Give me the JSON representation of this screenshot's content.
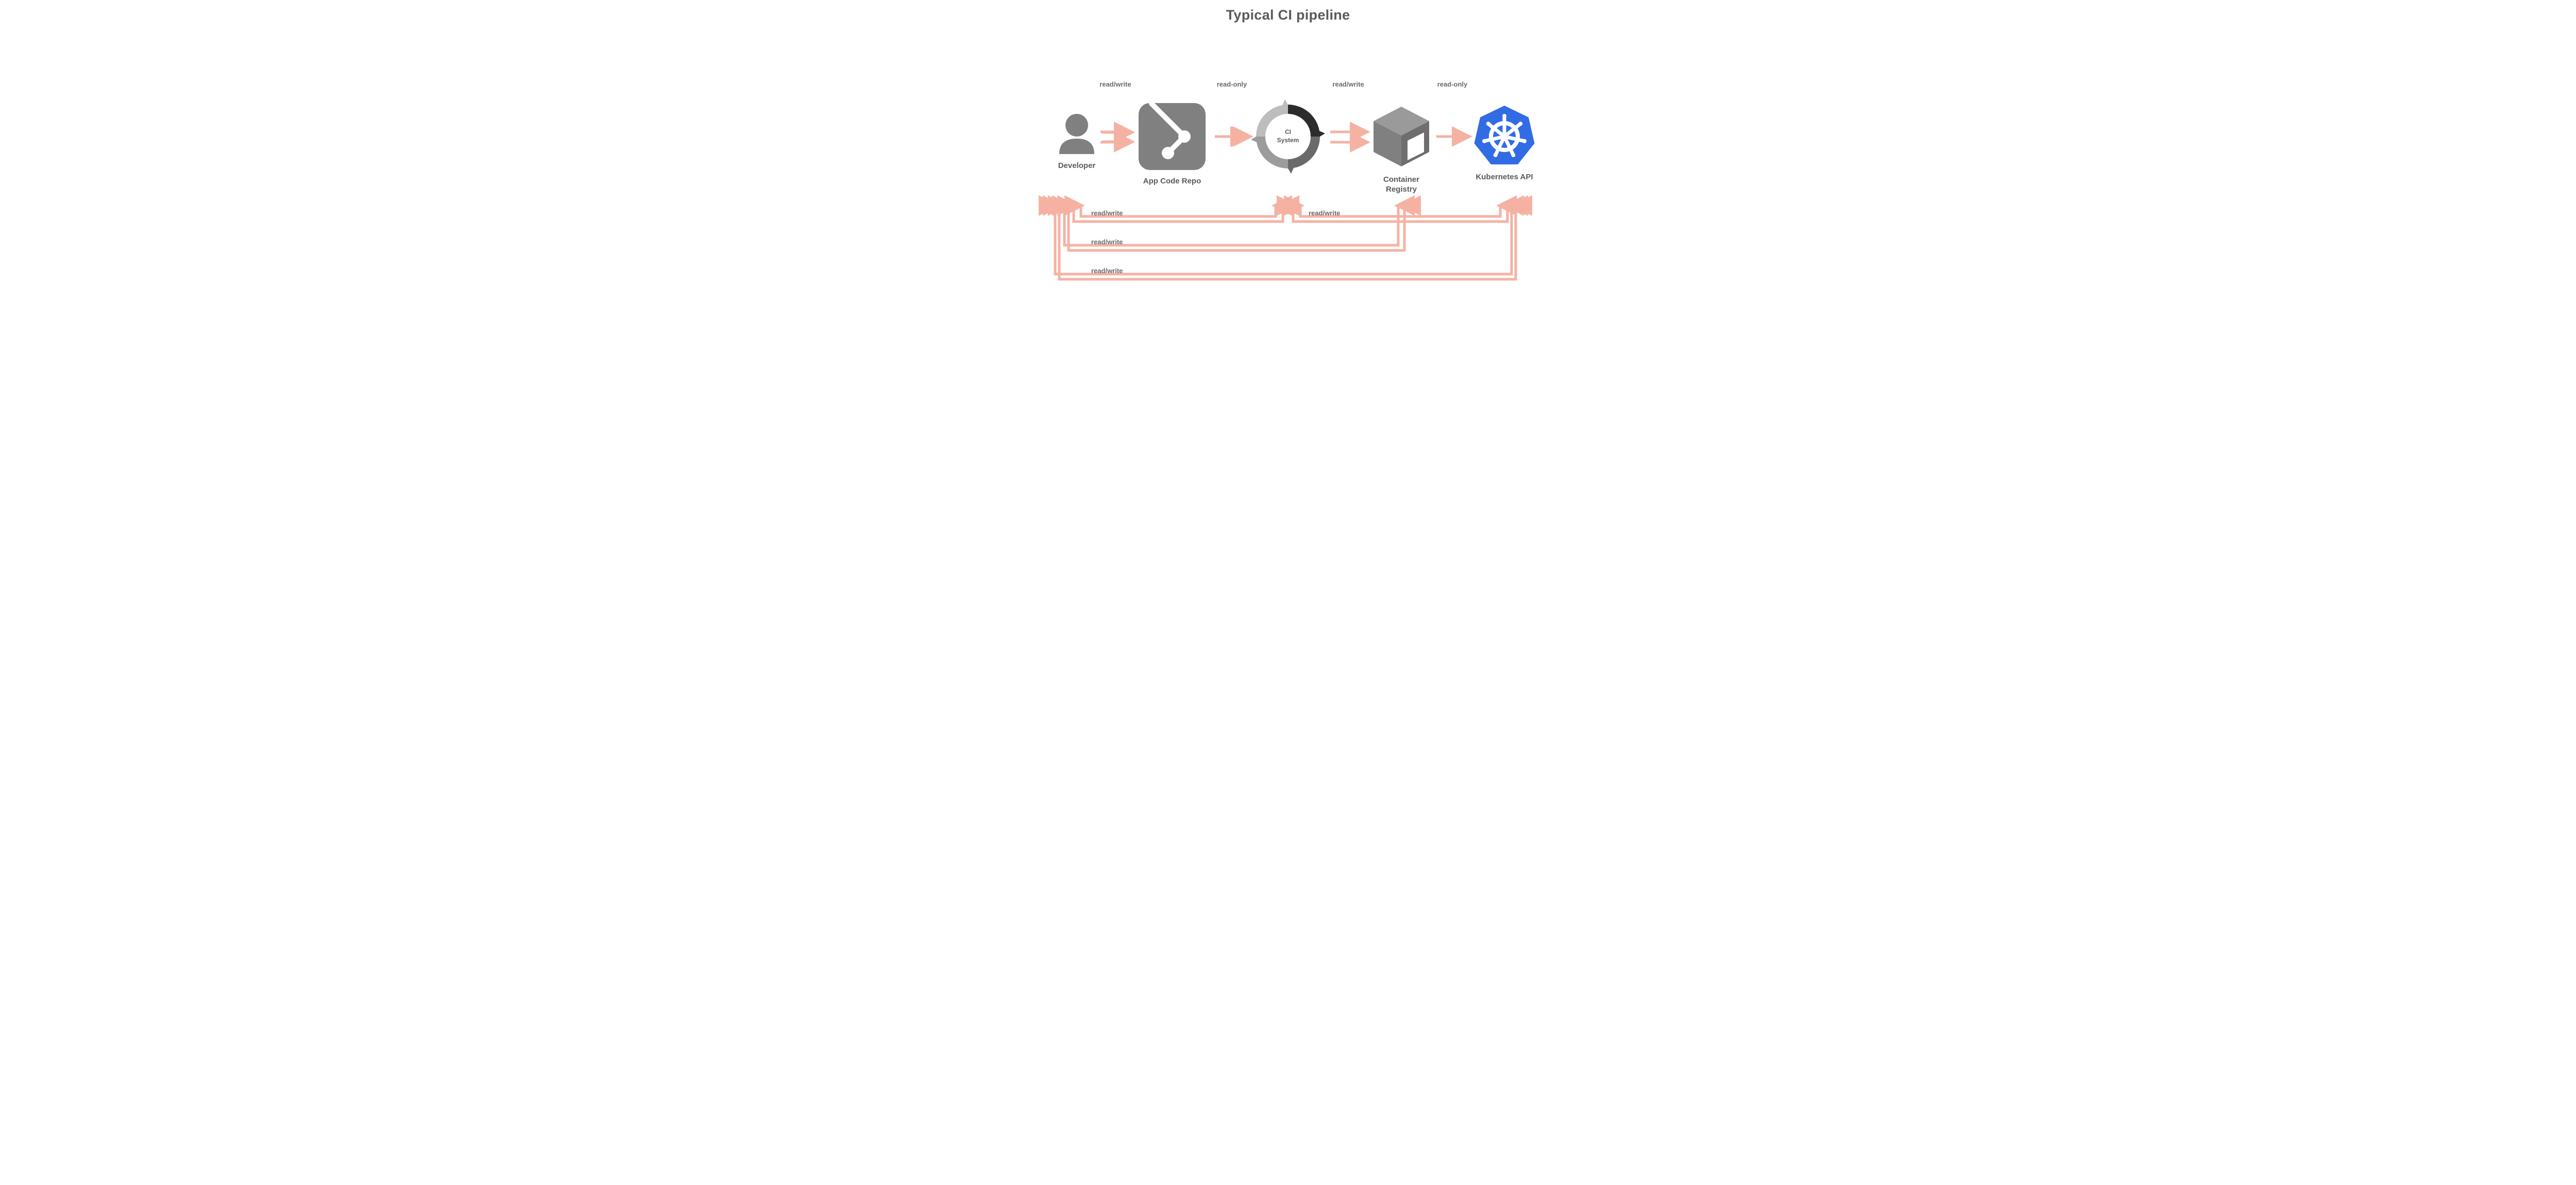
{
  "title": "Typical CI pipeline",
  "nodes": {
    "developer": {
      "label": "Developer"
    },
    "repo": {
      "label": "App Code Repo"
    },
    "ci": {
      "label1": "CI",
      "label2": "System"
    },
    "registry": {
      "label1": "Container",
      "label2": "Registry"
    },
    "k8s": {
      "label": "Kubernetes API"
    }
  },
  "topEdges": {
    "e1": "read/write",
    "e2": "read-only",
    "e3": "read/write",
    "e4": "read-only"
  },
  "bottomEdges": {
    "b1": "read/write",
    "b2": "read/write",
    "b3": "read/write",
    "b4": "read/write"
  },
  "colors": {
    "arrow": "#f5b2a3",
    "nodeGray": "#808080",
    "nodeDark": "#2a2a2a",
    "k8sBlue": "#326ce5",
    "k8sWhite": "#ffffff"
  }
}
